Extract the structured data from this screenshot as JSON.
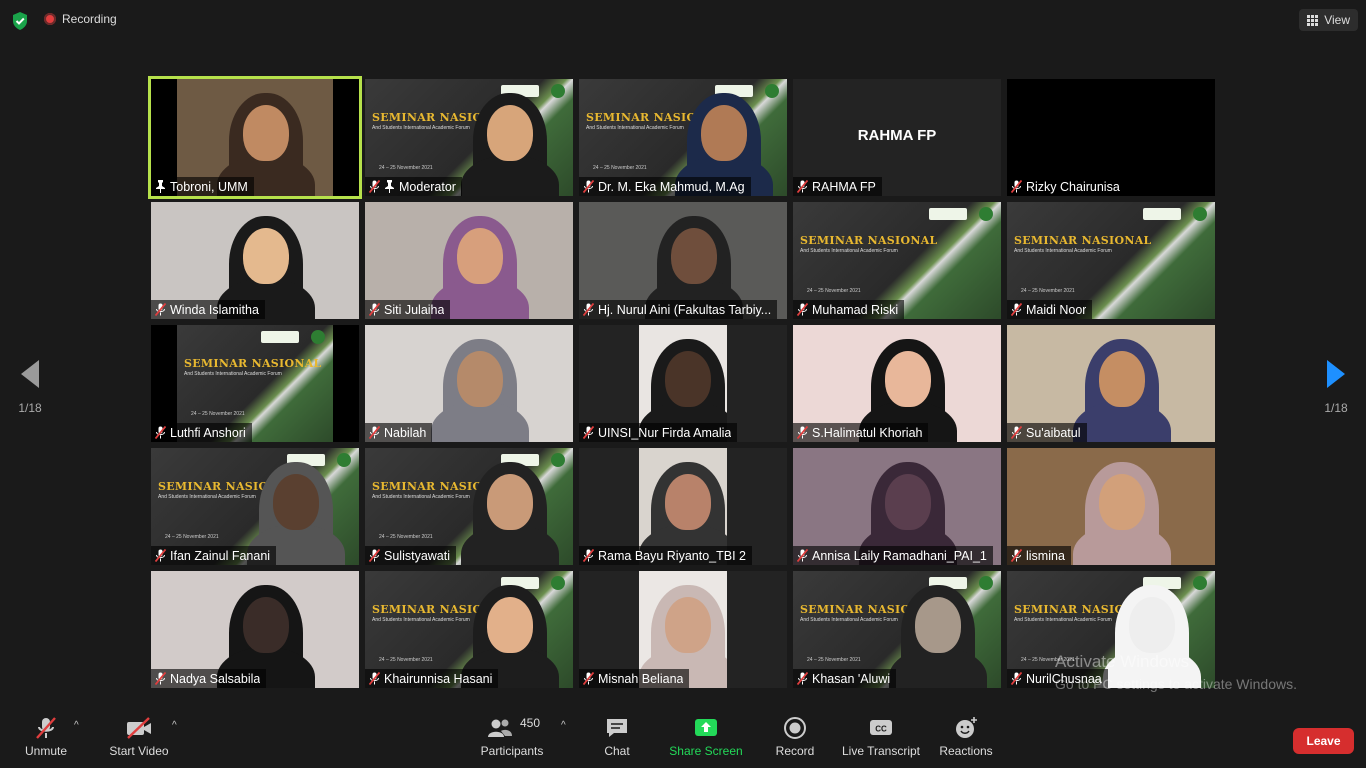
{
  "topbar": {
    "recording_label": "Recording",
    "view_label": "View"
  },
  "navigation": {
    "prev_page": "1/18",
    "next_page": "1/18"
  },
  "slide": {
    "title": "SEMINAR NASIONAL",
    "subtitle": "And Students International Academic Forum",
    "date": "24 – 25 November 2021"
  },
  "participants_tiles": [
    {
      "name": "Tobroni, UMM",
      "active": true
    },
    {
      "name": "Moderator"
    },
    {
      "name": "Dr. M. Eka Mahmud, M.Ag"
    },
    {
      "name": "RAHMA FP",
      "center_name": "RAHMA FP"
    },
    {
      "name": "Rizky Chairunisa"
    },
    {
      "name": "Winda Islamitha"
    },
    {
      "name": "Siti Julaiha"
    },
    {
      "name": "Hj. Nurul Aini (Fakultas Tarbiy..."
    },
    {
      "name": "Muhamad Riski"
    },
    {
      "name": "Maidi Noor"
    },
    {
      "name": "Luthfi Anshori"
    },
    {
      "name": "Nabilah"
    },
    {
      "name": "UINSI_Nur Firda Amalia"
    },
    {
      "name": "S.Halimatul Khoriah"
    },
    {
      "name": "Su'aibatul"
    },
    {
      "name": "Ifan Zainul Fanani"
    },
    {
      "name": "Sulistyawati"
    },
    {
      "name": "Rama Bayu Riyanto_TBI 2"
    },
    {
      "name": "Annisa Laily Ramadhani_PAI_1"
    },
    {
      "name": "lismina"
    },
    {
      "name": "Nadya Salsabila"
    },
    {
      "name": "Khairunnisa Hasani"
    },
    {
      "name": "Misnah Beliana"
    },
    {
      "name": "Khasan 'Aluwi"
    },
    {
      "name": "NurilChusnaa"
    }
  ],
  "watermark": {
    "line1": "Activate Windows",
    "line2": "Go to PC settings to activate Windows."
  },
  "toolbar": {
    "unmute": "Unmute",
    "start_video": "Start Video",
    "participants": "Participants",
    "participant_count": "450",
    "chat": "Chat",
    "share_screen": "Share Screen",
    "record": "Record",
    "live_transcript": "Live Transcript",
    "reactions": "Reactions",
    "leave": "Leave"
  },
  "colors": {
    "active_speaker": "#b6e14b",
    "share_green": "#23d959",
    "leave_red": "#d62e2e",
    "nav_blue": "#1e90ff"
  }
}
